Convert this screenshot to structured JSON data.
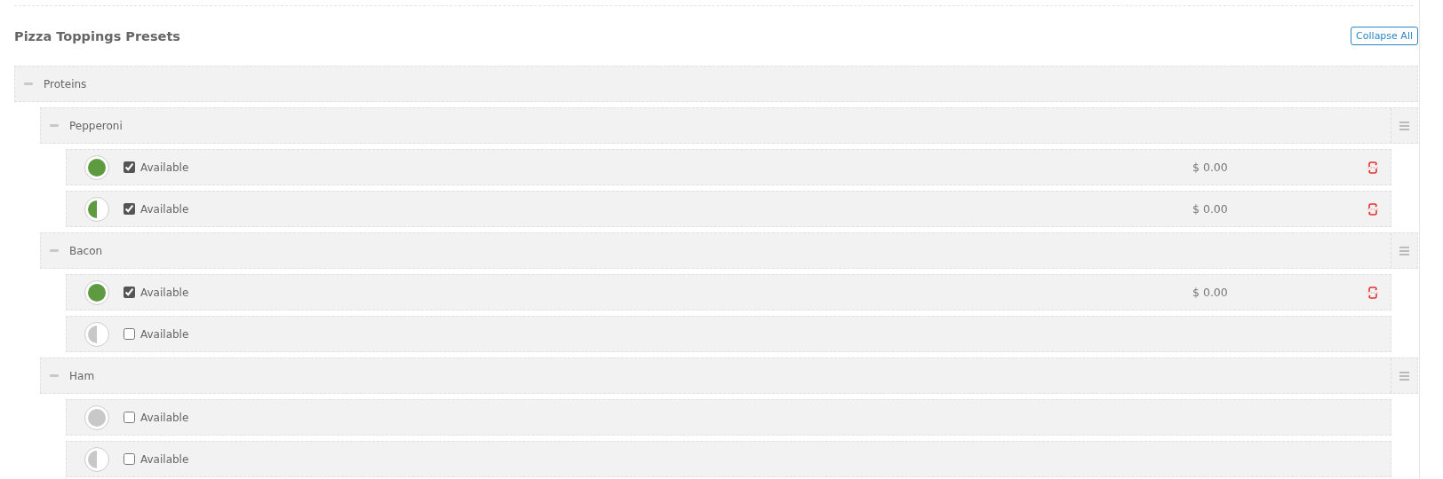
{
  "section": {
    "title": "Pizza Toppings Presets",
    "collapse_button": "Collapse All"
  },
  "groups": [
    {
      "name": "Proteins",
      "expanded": true,
      "items": [
        {
          "name": "Pepperoni",
          "expanded": true,
          "options": [
            {
              "kind": "whole",
              "available": true,
              "label": "Available",
              "price": "$ 0.00"
            },
            {
              "kind": "half",
              "available": true,
              "label": "Available",
              "price": "$ 0.00"
            }
          ]
        },
        {
          "name": "Bacon",
          "expanded": true,
          "options": [
            {
              "kind": "whole",
              "available": true,
              "label": "Available",
              "price": "$ 0.00"
            },
            {
              "kind": "half",
              "available": false,
              "label": "Available"
            }
          ]
        },
        {
          "name": "Ham",
          "expanded": true,
          "options": [
            {
              "kind": "whole",
              "available": false,
              "label": "Available"
            },
            {
              "kind": "half",
              "available": false,
              "label": "Available"
            }
          ]
        }
      ]
    }
  ]
}
